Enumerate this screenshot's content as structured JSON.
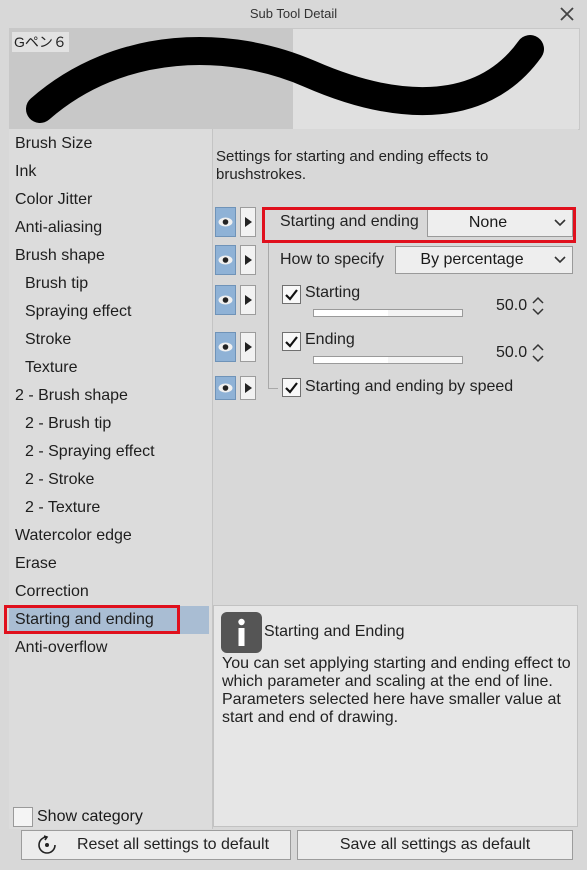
{
  "window": {
    "title": "Sub Tool Detail"
  },
  "preview": {
    "label": "Gペン６"
  },
  "categories": [
    {
      "label": "Brush Size",
      "indent": false
    },
    {
      "label": "Ink",
      "indent": false
    },
    {
      "label": "Color Jitter",
      "indent": false
    },
    {
      "label": "Anti-aliasing",
      "indent": false
    },
    {
      "label": "Brush shape",
      "indent": false
    },
    {
      "label": "Brush tip",
      "indent": true
    },
    {
      "label": "Spraying effect",
      "indent": true
    },
    {
      "label": "Stroke",
      "indent": true
    },
    {
      "label": "Texture",
      "indent": true
    },
    {
      "label": "2 - Brush shape",
      "indent": false
    },
    {
      "label": "2 - Brush tip",
      "indent": true
    },
    {
      "label": "2 - Spraying effect",
      "indent": true
    },
    {
      "label": "2 - Stroke",
      "indent": true
    },
    {
      "label": "2 - Texture",
      "indent": true
    },
    {
      "label": "Watercolor edge",
      "indent": false
    },
    {
      "label": "Erase",
      "indent": false
    },
    {
      "label": "Correction",
      "indent": false
    },
    {
      "label": "Starting and ending",
      "indent": false,
      "selected": true
    },
    {
      "label": "Anti-overflow",
      "indent": false
    }
  ],
  "show_category": {
    "label": "Show category",
    "checked": false
  },
  "settings": {
    "description": "Settings for starting and ending effects to brushstrokes.",
    "starting_and_ending": {
      "label": "Starting and ending",
      "value": "None"
    },
    "how_to_specify": {
      "label": "How to specify",
      "value": "By percentage"
    },
    "starting": {
      "label": "Starting",
      "checked": true,
      "value": "50.0",
      "level": 0.5
    },
    "ending": {
      "label": "Ending",
      "checked": true,
      "value": "50.0",
      "level": 0.5
    },
    "by_speed": {
      "label": "Starting and ending by speed",
      "checked": true
    }
  },
  "help": {
    "title": "Starting and Ending",
    "body": "You can set applying starting and ending effect to which parameter and scaling at the end of line.\nParameters selected here have smaller value at start and end of drawing."
  },
  "buttons": {
    "reset": "Reset all settings to default",
    "save": "Save all settings as default"
  },
  "colors": {
    "highlight": "#e0101d",
    "selected_bg": "#a9bdd3",
    "eye_bg": "#8fb2d6"
  }
}
